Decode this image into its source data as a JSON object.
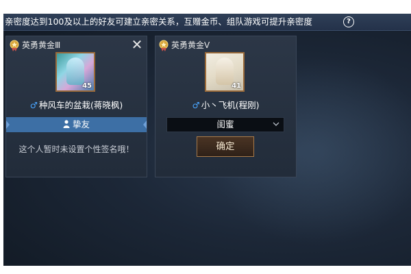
{
  "topbar": {
    "tip": "亲密度达到100及以上的好友可建立亲密关系，互赠金币、组队游戏可提升亲密度",
    "help_label": "?"
  },
  "cards": [
    {
      "rank": "英勇黄金Ⅲ",
      "close_glyph": "✕",
      "avatar_level": "45",
      "player": "种风车的盆栽(蒋晓枫)",
      "relation": "挚友",
      "signature": "这个人暂时未设置个性签名哦！"
    },
    {
      "rank": "英勇黄金Ⅴ",
      "player": "小丶飞机(程刚)",
      "avatar_level": "41",
      "relation_select": "闺蜜",
      "confirm": "确定"
    }
  ],
  "colors": {
    "accent_blue": "#3d6fa5",
    "male_icon": "#4aa6ff",
    "confirm_border": "#a97b4a"
  },
  "icons": {
    "medal": "gold-medal-icon",
    "male": "male-symbol-icon",
    "relation": "friend-icon",
    "dropdown": "chevron-down-icon",
    "help": "question-circle-icon"
  }
}
